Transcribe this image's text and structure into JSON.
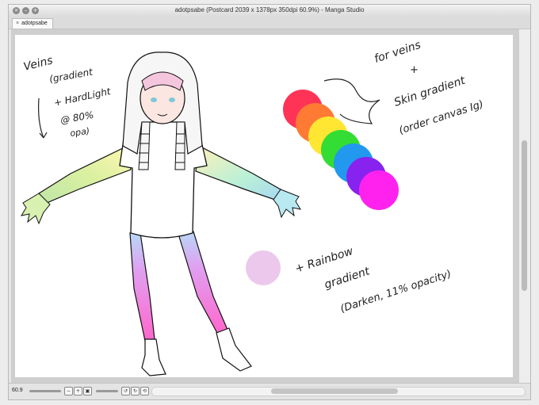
{
  "window": {
    "title": "adotpsabe (Postcard 2039 x 1378px 350dpi 60.9%) - Manga Studio",
    "tab_label": "adotpsabe"
  },
  "canvas": {
    "notes": {
      "veins_lines": [
        "Veins",
        "(gradient",
        "+ HardLight",
        "@ 80%",
        "opa)"
      ],
      "skin_lines": [
        "for veins",
        "+",
        "Skin gradient",
        "(order canvas Ig)"
      ],
      "rainbow_lines": [
        "+ Rainbow",
        "gradient",
        "(Darken, 11% opacity)"
      ]
    },
    "swatch_colors": [
      "#ff3355",
      "#ff7a33",
      "#ffe633",
      "#33dd33",
      "#2299ee",
      "#8822ee",
      "#ff22ee"
    ],
    "pale_swatch_color": "#ecc8ec"
  },
  "status": {
    "zoom": "60.9"
  }
}
